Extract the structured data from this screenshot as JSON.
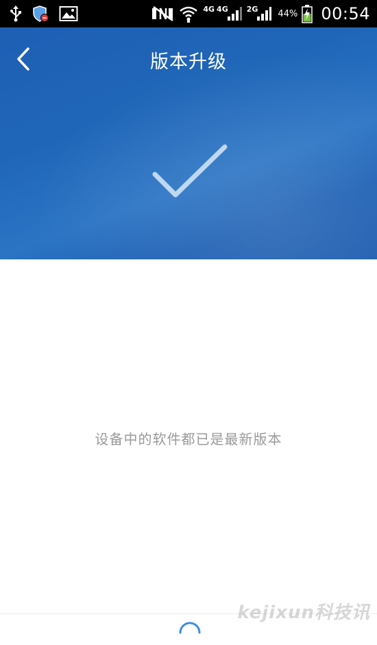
{
  "status_bar": {
    "icons_left": [
      "usb-icon",
      "security-shield-icon",
      "image-icon"
    ],
    "network_1": "4G",
    "network_2": "4G",
    "network_3": "2G",
    "battery": "44%",
    "time": "00:54"
  },
  "header": {
    "title": "版本升级",
    "back_icon": "chevron-left-icon",
    "status_icon": "checkmark-icon",
    "background_color": "#1f66b8"
  },
  "main": {
    "message": "设备中的软件都已是最新版本"
  },
  "footer": {
    "spinner_icon": "loading-spinner-icon",
    "watermark": "kejixun科技讯"
  }
}
